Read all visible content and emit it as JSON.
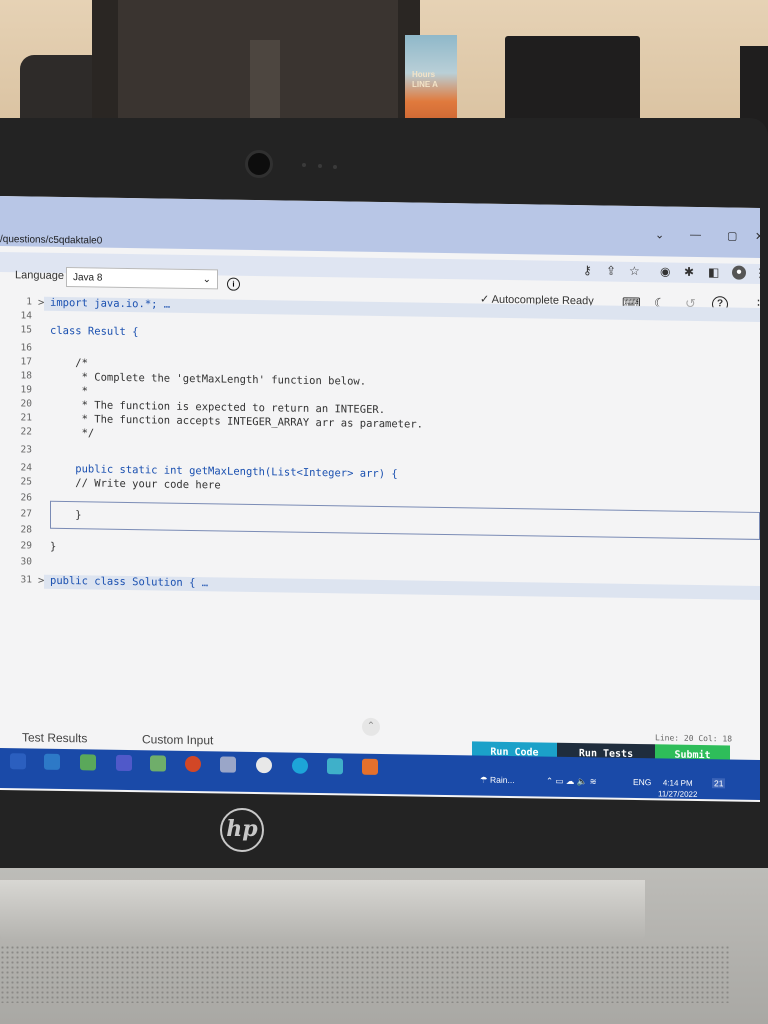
{
  "browser": {
    "url_fragment": "/questions/c5qdaktale0",
    "window_controls": [
      "⌄",
      "—",
      "▢",
      "✕"
    ],
    "toolbar_icons": [
      "key-icon",
      "share-icon",
      "star-icon",
      "camera-icon",
      "extension-icon",
      "sidepanel-icon",
      "profile-icon",
      "menu-icon"
    ]
  },
  "editor_header": {
    "language_label": "Language",
    "language_value": "Java 8",
    "autocomplete_status": "Autocomplete Ready"
  },
  "code_lines": [
    {
      "num": "1",
      "fold": ">",
      "text": "import java.io.*; …"
    },
    {
      "num": "14",
      "fold": "",
      "text": ""
    },
    {
      "num": "15",
      "fold": "",
      "text": "class Result {"
    },
    {
      "num": "16",
      "fold": "",
      "text": ""
    },
    {
      "num": "17",
      "fold": "",
      "text": "    /*"
    },
    {
      "num": "18",
      "fold": "",
      "text": "     * Complete the 'getMaxLength' function below."
    },
    {
      "num": "19",
      "fold": "",
      "text": "     *"
    },
    {
      "num": "20",
      "fold": "",
      "text": "     * The function is expected to return an INTEGER."
    },
    {
      "num": "21",
      "fold": "",
      "text": "     * The function accepts INTEGER_ARRAY arr as parameter."
    },
    {
      "num": "22",
      "fold": "",
      "text": "     */"
    },
    {
      "num": "23",
      "fold": "",
      "text": ""
    },
    {
      "num": "24",
      "fold": "",
      "text": "    public static int getMaxLength(List<Integer> arr) {"
    },
    {
      "num": "25",
      "fold": "",
      "text": "    // Write your code here"
    },
    {
      "num": "26",
      "fold": "",
      "text": ""
    },
    {
      "num": "27",
      "fold": "",
      "text": "    }"
    },
    {
      "num": "28",
      "fold": "",
      "text": ""
    },
    {
      "num": "29",
      "fold": "",
      "text": "}"
    },
    {
      "num": "30",
      "fold": "",
      "text": ""
    },
    {
      "num": "31",
      "fold": ">",
      "text": "public class Solution { …"
    }
  ],
  "status": {
    "cursor_position": "Line: 20 Col: 18"
  },
  "bottom_tabs": {
    "test_results": "Test Results",
    "custom_input": "Custom Input"
  },
  "actions": {
    "run_code": "Run Code",
    "run_tests": "Run Tests",
    "submit": "Submit"
  },
  "taskbar": {
    "weather": "Rain...",
    "language": "ENG",
    "time": "4:14 PM",
    "date": "11/27/2022",
    "notification_count": "21"
  },
  "scene": {
    "poster_text": "Hours\nLINE A"
  }
}
